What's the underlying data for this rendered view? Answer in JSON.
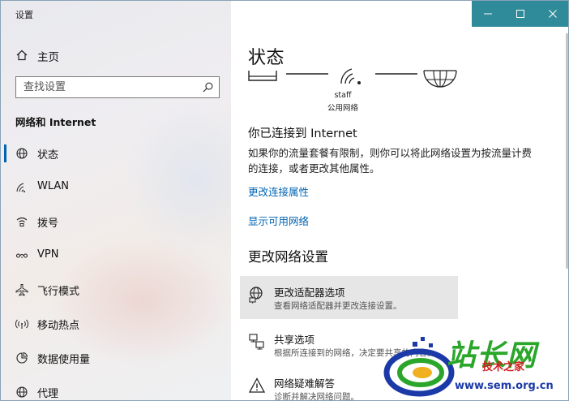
{
  "window": {
    "title": "设置"
  },
  "sidebar": {
    "home_label": "主页",
    "search_placeholder": "查找设置",
    "section_title": "网络和 Internet",
    "items": [
      {
        "label": "状态",
        "icon": "globe-icon",
        "active": true
      },
      {
        "label": "WLAN",
        "icon": "wifi-icon",
        "active": false
      },
      {
        "label": "拨号",
        "icon": "dialup-icon",
        "active": false
      },
      {
        "label": "VPN",
        "icon": "vpn-icon",
        "active": false
      },
      {
        "label": "飞行模式",
        "icon": "airplane-icon",
        "active": false
      },
      {
        "label": "移动热点",
        "icon": "hotspot-icon",
        "active": false
      },
      {
        "label": "数据使用量",
        "icon": "data-usage-icon",
        "active": false
      },
      {
        "label": "代理",
        "icon": "proxy-globe-icon",
        "active": false
      }
    ]
  },
  "main": {
    "title": "状态",
    "network": {
      "name": "staff",
      "type": "公用网络"
    },
    "connected_title": "你已连接到 Internet",
    "connected_desc": "如果你的流量套餐有限制，则你可以将此网络设置为按流量计费的连接，或者更改其他属性。",
    "links": {
      "change_properties": "更改连接属性",
      "show_networks": "显示可用网络"
    },
    "section_title": "更改网络设置",
    "options": [
      {
        "title": "更改适配器选项",
        "desc": "查看网络适配器并更改连接设置。",
        "icon": "adapter-icon"
      },
      {
        "title": "共享选项",
        "desc": "根据所连接到的网络，决定要共享的内容。",
        "icon": "sharing-icon"
      },
      {
        "title": "网络疑难解答",
        "desc": "诊断并解决网络问题。",
        "icon": "warning-icon"
      }
    ]
  },
  "watermark": {
    "brand": "站长网",
    "brand_sub": "技术之家",
    "url": "www.sem.org.cn"
  },
  "colors": {
    "accent": "#0063b1",
    "titlebar": "#2f8a99",
    "hover": "#e6e6e6"
  }
}
